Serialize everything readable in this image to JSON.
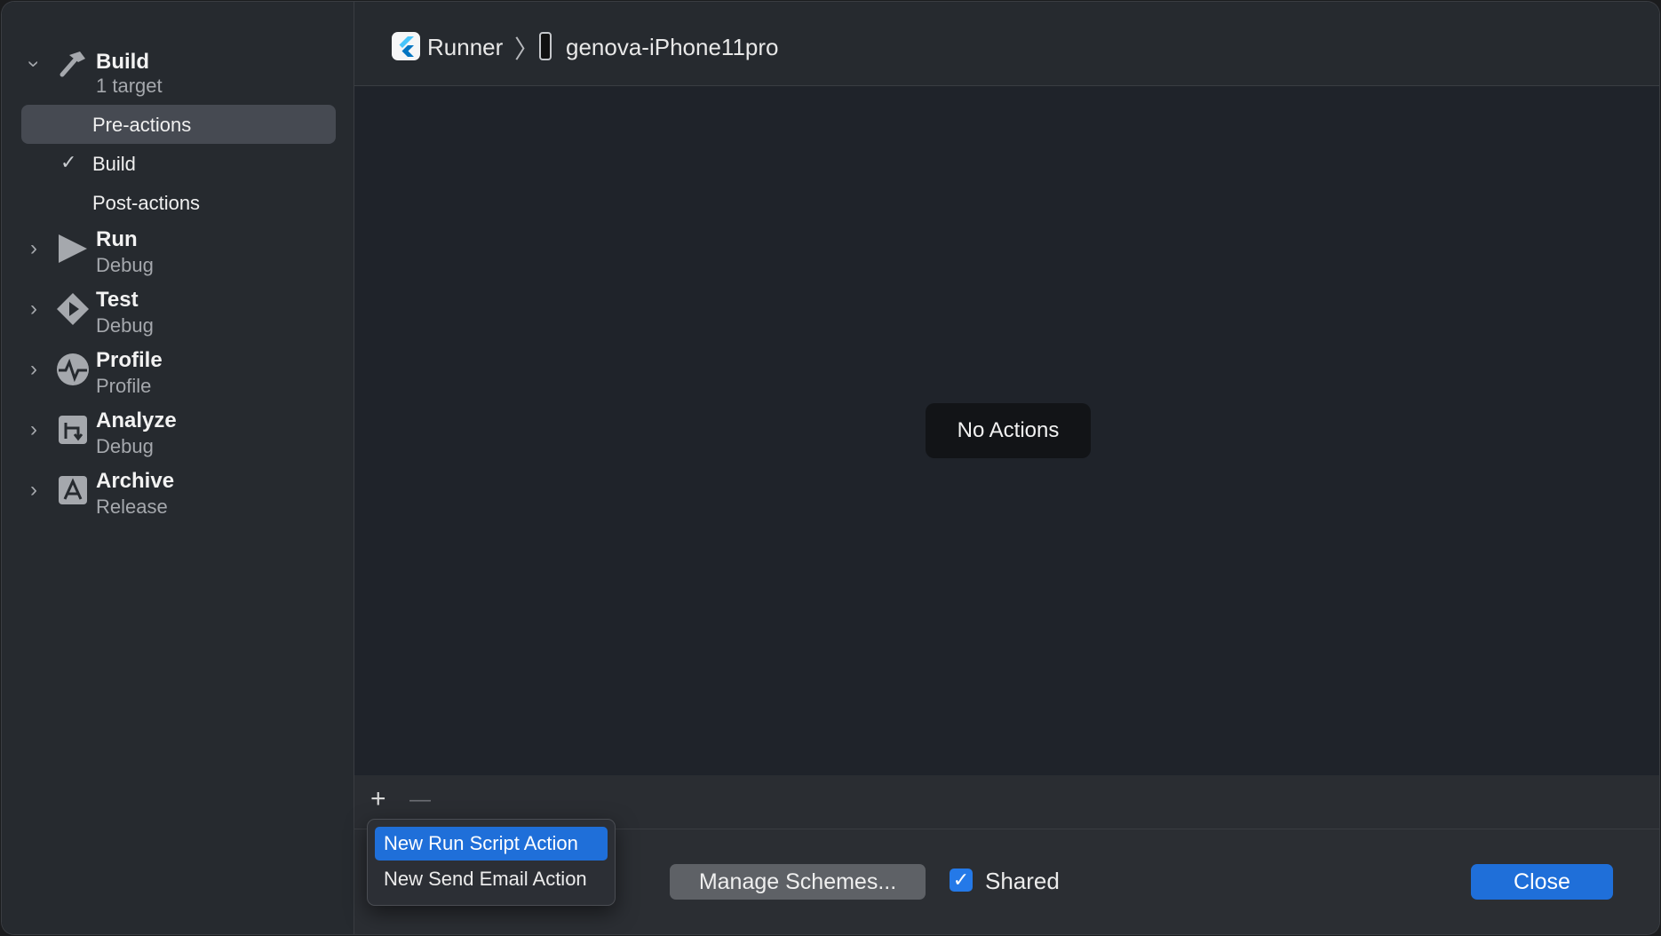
{
  "sidebar": {
    "sections": [
      {
        "id": "build",
        "title": "Build",
        "subtitle": "1 target",
        "icon": "hammer-icon",
        "expanded": true
      },
      {
        "id": "run",
        "title": "Run",
        "subtitle": "Debug",
        "icon": "play-icon",
        "expanded": false
      },
      {
        "id": "test",
        "title": "Test",
        "subtitle": "Debug",
        "icon": "test-diamond-icon",
        "expanded": false
      },
      {
        "id": "profile",
        "title": "Profile",
        "subtitle": "Profile",
        "icon": "waveform-icon",
        "expanded": false
      },
      {
        "id": "analyze",
        "title": "Analyze",
        "subtitle": "Debug",
        "icon": "analyze-icon",
        "expanded": false
      },
      {
        "id": "archive",
        "title": "Archive",
        "subtitle": "Release",
        "icon": "archive-icon",
        "expanded": false
      }
    ],
    "build_items": [
      {
        "label": "Pre-actions",
        "selected": true,
        "checked": false
      },
      {
        "label": "Build",
        "selected": false,
        "checked": true
      },
      {
        "label": "Post-actions",
        "selected": false,
        "checked": false
      }
    ]
  },
  "header": {
    "scheme": "Runner",
    "device": "genova-iPhone11pro"
  },
  "content": {
    "empty_label": "No Actions"
  },
  "toolbar": {
    "add_label": "+",
    "remove_label": "—"
  },
  "popup": {
    "items": [
      "New Run Script Action",
      "New Send Email Action"
    ]
  },
  "bottom": {
    "manage_label": "Manage Schemes...",
    "shared_label": "Shared",
    "shared_checked": true,
    "close_label": "Close"
  },
  "colors": {
    "accent": "#1f6fd9",
    "sidebar_bg": "#262a2f",
    "content_bg": "#1f232a"
  }
}
